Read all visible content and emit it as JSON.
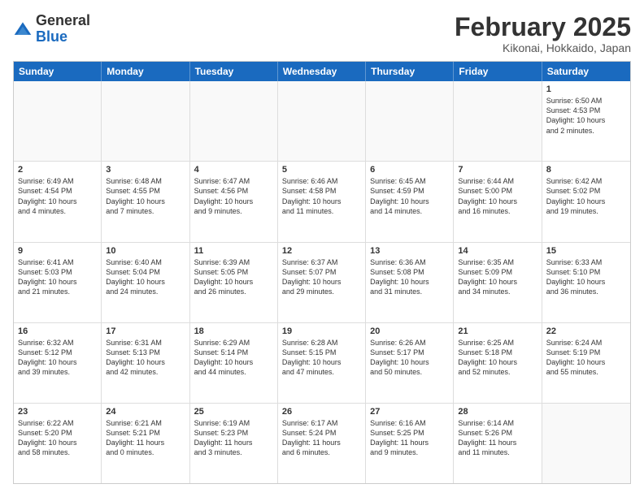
{
  "logo": {
    "general": "General",
    "blue": "Blue"
  },
  "title": "February 2025",
  "subtitle": "Kikonai, Hokkaido, Japan",
  "header_days": [
    "Sunday",
    "Monday",
    "Tuesday",
    "Wednesday",
    "Thursday",
    "Friday",
    "Saturday"
  ],
  "rows": [
    [
      {
        "day": "",
        "text": "",
        "empty": true
      },
      {
        "day": "",
        "text": "",
        "empty": true
      },
      {
        "day": "",
        "text": "",
        "empty": true
      },
      {
        "day": "",
        "text": "",
        "empty": true
      },
      {
        "day": "",
        "text": "",
        "empty": true
      },
      {
        "day": "",
        "text": "",
        "empty": true
      },
      {
        "day": "1",
        "text": "Sunrise: 6:50 AM\nSunset: 4:53 PM\nDaylight: 10 hours\nand 2 minutes.",
        "empty": false
      }
    ],
    [
      {
        "day": "2",
        "text": "Sunrise: 6:49 AM\nSunset: 4:54 PM\nDaylight: 10 hours\nand 4 minutes.",
        "empty": false
      },
      {
        "day": "3",
        "text": "Sunrise: 6:48 AM\nSunset: 4:55 PM\nDaylight: 10 hours\nand 7 minutes.",
        "empty": false
      },
      {
        "day": "4",
        "text": "Sunrise: 6:47 AM\nSunset: 4:56 PM\nDaylight: 10 hours\nand 9 minutes.",
        "empty": false
      },
      {
        "day": "5",
        "text": "Sunrise: 6:46 AM\nSunset: 4:58 PM\nDaylight: 10 hours\nand 11 minutes.",
        "empty": false
      },
      {
        "day": "6",
        "text": "Sunrise: 6:45 AM\nSunset: 4:59 PM\nDaylight: 10 hours\nand 14 minutes.",
        "empty": false
      },
      {
        "day": "7",
        "text": "Sunrise: 6:44 AM\nSunset: 5:00 PM\nDaylight: 10 hours\nand 16 minutes.",
        "empty": false
      },
      {
        "day": "8",
        "text": "Sunrise: 6:42 AM\nSunset: 5:02 PM\nDaylight: 10 hours\nand 19 minutes.",
        "empty": false
      }
    ],
    [
      {
        "day": "9",
        "text": "Sunrise: 6:41 AM\nSunset: 5:03 PM\nDaylight: 10 hours\nand 21 minutes.",
        "empty": false
      },
      {
        "day": "10",
        "text": "Sunrise: 6:40 AM\nSunset: 5:04 PM\nDaylight: 10 hours\nand 24 minutes.",
        "empty": false
      },
      {
        "day": "11",
        "text": "Sunrise: 6:39 AM\nSunset: 5:05 PM\nDaylight: 10 hours\nand 26 minutes.",
        "empty": false
      },
      {
        "day": "12",
        "text": "Sunrise: 6:37 AM\nSunset: 5:07 PM\nDaylight: 10 hours\nand 29 minutes.",
        "empty": false
      },
      {
        "day": "13",
        "text": "Sunrise: 6:36 AM\nSunset: 5:08 PM\nDaylight: 10 hours\nand 31 minutes.",
        "empty": false
      },
      {
        "day": "14",
        "text": "Sunrise: 6:35 AM\nSunset: 5:09 PM\nDaylight: 10 hours\nand 34 minutes.",
        "empty": false
      },
      {
        "day": "15",
        "text": "Sunrise: 6:33 AM\nSunset: 5:10 PM\nDaylight: 10 hours\nand 36 minutes.",
        "empty": false
      }
    ],
    [
      {
        "day": "16",
        "text": "Sunrise: 6:32 AM\nSunset: 5:12 PM\nDaylight: 10 hours\nand 39 minutes.",
        "empty": false
      },
      {
        "day": "17",
        "text": "Sunrise: 6:31 AM\nSunset: 5:13 PM\nDaylight: 10 hours\nand 42 minutes.",
        "empty": false
      },
      {
        "day": "18",
        "text": "Sunrise: 6:29 AM\nSunset: 5:14 PM\nDaylight: 10 hours\nand 44 minutes.",
        "empty": false
      },
      {
        "day": "19",
        "text": "Sunrise: 6:28 AM\nSunset: 5:15 PM\nDaylight: 10 hours\nand 47 minutes.",
        "empty": false
      },
      {
        "day": "20",
        "text": "Sunrise: 6:26 AM\nSunset: 5:17 PM\nDaylight: 10 hours\nand 50 minutes.",
        "empty": false
      },
      {
        "day": "21",
        "text": "Sunrise: 6:25 AM\nSunset: 5:18 PM\nDaylight: 10 hours\nand 52 minutes.",
        "empty": false
      },
      {
        "day": "22",
        "text": "Sunrise: 6:24 AM\nSunset: 5:19 PM\nDaylight: 10 hours\nand 55 minutes.",
        "empty": false
      }
    ],
    [
      {
        "day": "23",
        "text": "Sunrise: 6:22 AM\nSunset: 5:20 PM\nDaylight: 10 hours\nand 58 minutes.",
        "empty": false
      },
      {
        "day": "24",
        "text": "Sunrise: 6:21 AM\nSunset: 5:21 PM\nDaylight: 11 hours\nand 0 minutes.",
        "empty": false
      },
      {
        "day": "25",
        "text": "Sunrise: 6:19 AM\nSunset: 5:23 PM\nDaylight: 11 hours\nand 3 minutes.",
        "empty": false
      },
      {
        "day": "26",
        "text": "Sunrise: 6:17 AM\nSunset: 5:24 PM\nDaylight: 11 hours\nand 6 minutes.",
        "empty": false
      },
      {
        "day": "27",
        "text": "Sunrise: 6:16 AM\nSunset: 5:25 PM\nDaylight: 11 hours\nand 9 minutes.",
        "empty": false
      },
      {
        "day": "28",
        "text": "Sunrise: 6:14 AM\nSunset: 5:26 PM\nDaylight: 11 hours\nand 11 minutes.",
        "empty": false
      },
      {
        "day": "",
        "text": "",
        "empty": true
      }
    ]
  ]
}
